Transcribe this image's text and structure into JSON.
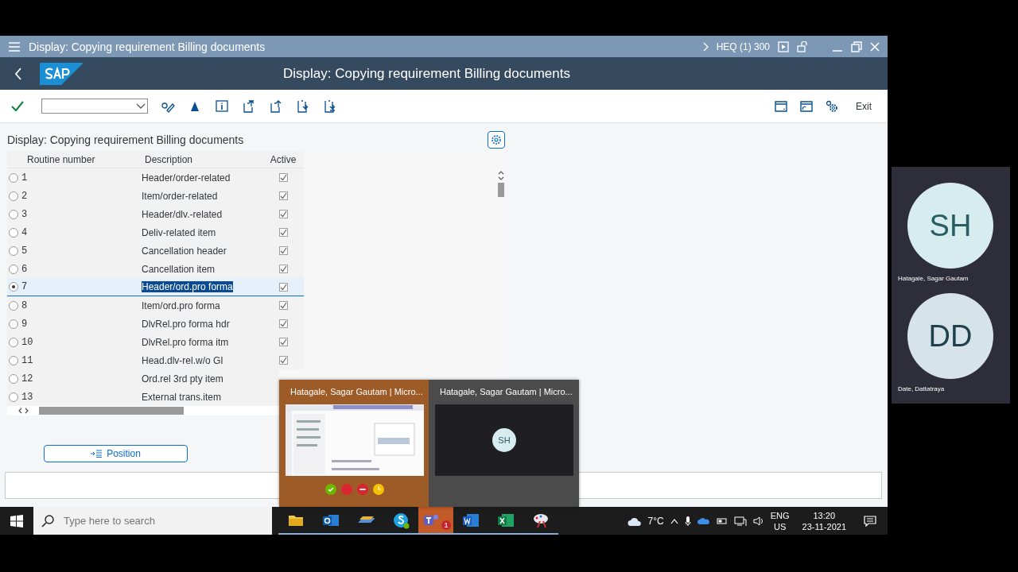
{
  "window": {
    "title": "Display: Copying requirement Billing documents",
    "system": "HEQ (1) 300"
  },
  "header": {
    "title": "Display: Copying requirement Billing documents"
  },
  "toolbar": {
    "exit": "Exit"
  },
  "panel": {
    "title": "Display: Copying requirement Billing documents",
    "table": {
      "columns": [
        "Routine number",
        "Description",
        "Active"
      ],
      "rows": [
        {
          "number": "1",
          "description": "Header/order-related",
          "active": true,
          "selected": false
        },
        {
          "number": "2",
          "description": "Item/order-related",
          "active": true,
          "selected": false
        },
        {
          "number": "3",
          "description": "Header/dlv.-related",
          "active": true,
          "selected": false
        },
        {
          "number": "4",
          "description": "Deliv-related item",
          "active": true,
          "selected": false
        },
        {
          "number": "5",
          "description": "Cancellation header",
          "active": true,
          "selected": false
        },
        {
          "number": "6",
          "description": "Cancellation item",
          "active": true,
          "selected": false
        },
        {
          "number": "7",
          "description": "Header/ord.pro forma",
          "active": true,
          "selected": true
        },
        {
          "number": "8",
          "description": "Item/ord.pro forma",
          "active": true,
          "selected": false
        },
        {
          "number": "9",
          "description": "DlvRel.pro forma hdr",
          "active": true,
          "selected": false
        },
        {
          "number": "10",
          "description": "DlvRel.pro forma itm",
          "active": true,
          "selected": false
        },
        {
          "number": "11",
          "description": "Head.dlv-rel.w/o GI",
          "active": true,
          "selected": false
        },
        {
          "number": "12",
          "description": "Ord.rel 3rd pty item",
          "selected": false
        },
        {
          "number": "13",
          "description": "External trans.item",
          "selected": false
        }
      ]
    },
    "position_button": "Position"
  },
  "thumbnails": [
    {
      "title": "Hatagale, Sagar Gautam | Micro...",
      "kind": "picture",
      "active": true
    },
    {
      "title": "Hatagale, Sagar Gautam | Micro...",
      "kind": "call",
      "initials": "SH",
      "active": false
    }
  ],
  "taskbar": {
    "search_placeholder": "Type here to search",
    "apps": [
      {
        "kind": "folder",
        "active": false
      },
      {
        "kind": "outlook",
        "active": false
      },
      {
        "kind": "sap",
        "active": false
      },
      {
        "kind": "skype",
        "active": false
      },
      {
        "kind": "teams",
        "active": true,
        "badge": "1"
      },
      {
        "kind": "word",
        "active": false
      },
      {
        "kind": "excel",
        "active": false
      },
      {
        "kind": "paint",
        "active": false
      }
    ],
    "temperature": "7°C",
    "language": "ENG",
    "region": "US",
    "time": "13:20",
    "date": "23-11-2021"
  },
  "participants": [
    {
      "initials": "SH",
      "name": "Hatagale, Sagar Gautam"
    },
    {
      "initials": "DD",
      "name": "Date, Dattatraya"
    }
  ]
}
